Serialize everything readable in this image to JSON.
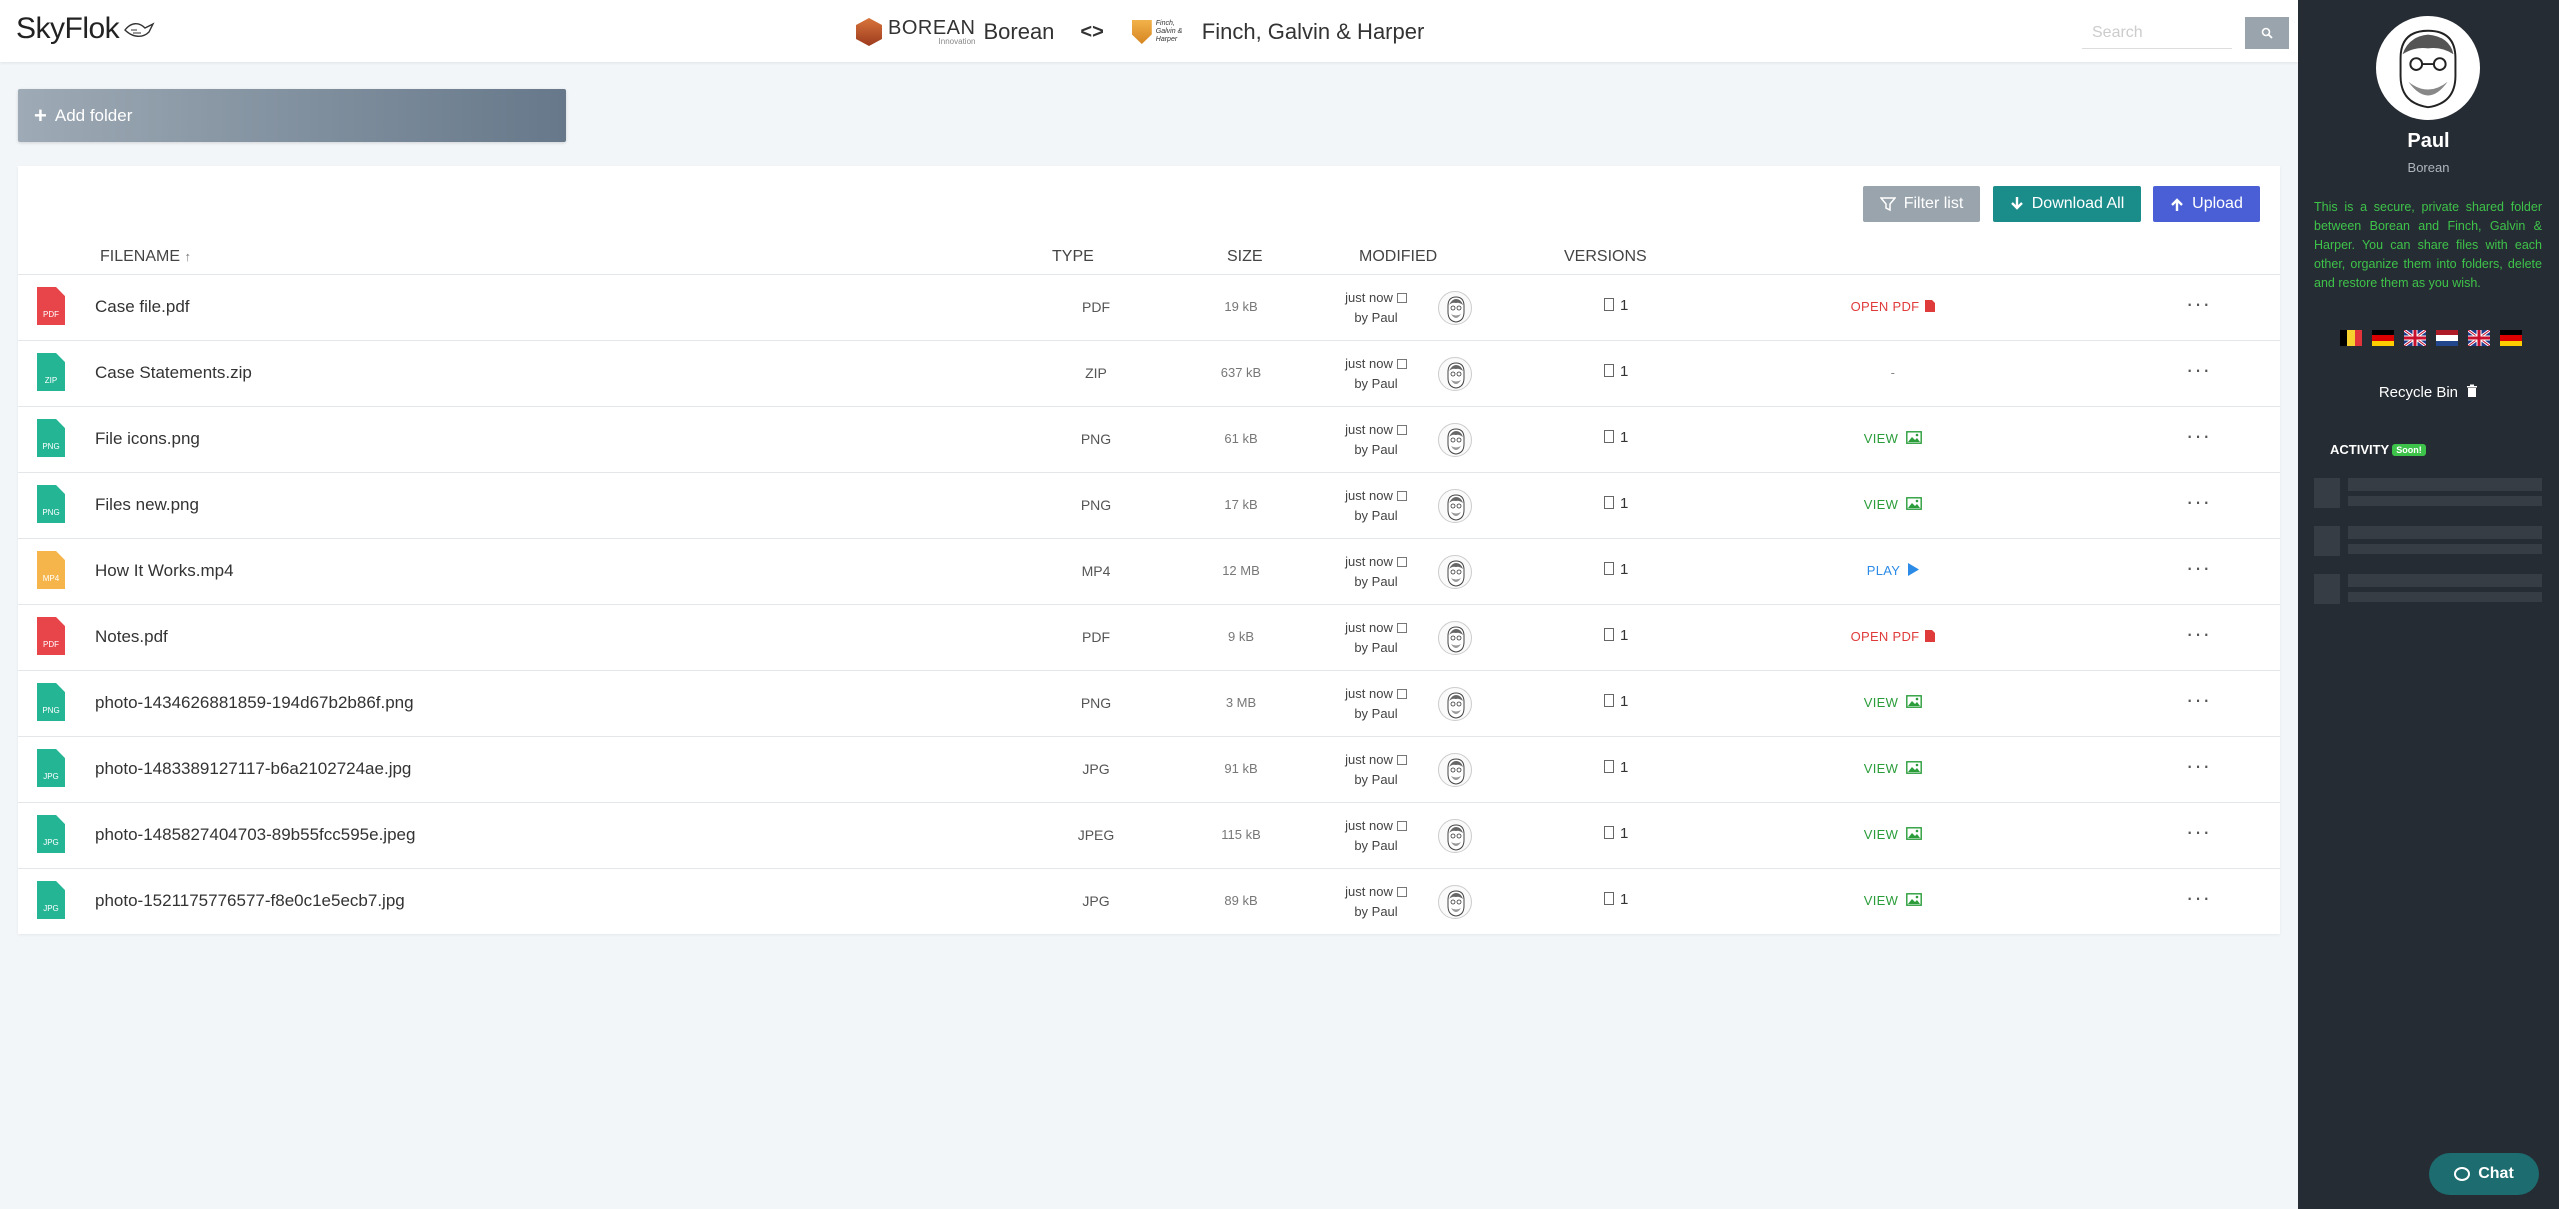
{
  "header": {
    "logo": "SkyFlok",
    "party1": {
      "brand": "BOREAN",
      "tagline": "Innovation",
      "name": "Borean"
    },
    "party2": {
      "mini": "Finch, Galvin & Harper",
      "name": "Finch, Galvin & Harper"
    },
    "swap_symbol": "<>",
    "search_placeholder": "Search"
  },
  "actions": {
    "add_folder": "Add folder",
    "filter": "Filter list",
    "download_all": "Download All",
    "upload": "Upload"
  },
  "columns": {
    "filename": "FILENAME",
    "sort_indicator": "↑",
    "type": "TYPE",
    "size": "SIZE",
    "modified": "MODIFIED",
    "versions": "VERSIONS"
  },
  "files": [
    {
      "icon_ext": "PDF",
      "icon_color": "#e8454a",
      "name": "Case file.pdf",
      "type": "PDF",
      "size": "19 kB",
      "modified": "just now",
      "by": "by Paul",
      "versions": "1",
      "action": "OPEN PDF",
      "action_kind": "pdf"
    },
    {
      "icon_ext": "ZIP",
      "icon_color": "#24b595",
      "name": "Case Statements.zip",
      "type": "ZIP",
      "size": "637 kB",
      "modified": "just now",
      "by": "by Paul",
      "versions": "1",
      "action": "-",
      "action_kind": "none"
    },
    {
      "icon_ext": "PNG",
      "icon_color": "#24b595",
      "name": "File icons.png",
      "type": "PNG",
      "size": "61 kB",
      "modified": "just now",
      "by": "by Paul",
      "versions": "1",
      "action": "VIEW",
      "action_kind": "view"
    },
    {
      "icon_ext": "PNG",
      "icon_color": "#24b595",
      "name": "Files new.png",
      "type": "PNG",
      "size": "17 kB",
      "modified": "just now",
      "by": "by Paul",
      "versions": "1",
      "action": "VIEW",
      "action_kind": "view"
    },
    {
      "icon_ext": "MP4",
      "icon_color": "#f5b54a",
      "name": "How It Works.mp4",
      "type": "MP4",
      "size": "12 MB",
      "modified": "just now",
      "by": "by Paul",
      "versions": "1",
      "action": "PLAY",
      "action_kind": "play"
    },
    {
      "icon_ext": "PDF",
      "icon_color": "#e8454a",
      "name": "Notes.pdf",
      "type": "PDF",
      "size": "9 kB",
      "modified": "just now",
      "by": "by Paul",
      "versions": "1",
      "action": "OPEN PDF",
      "action_kind": "pdf"
    },
    {
      "icon_ext": "PNG",
      "icon_color": "#24b595",
      "name": "photo-1434626881859-194d67b2b86f.png",
      "type": "PNG",
      "size": "3 MB",
      "modified": "just now",
      "by": "by Paul",
      "versions": "1",
      "action": "VIEW",
      "action_kind": "view"
    },
    {
      "icon_ext": "JPG",
      "icon_color": "#24b595",
      "name": "photo-1483389127117-b6a2102724ae.jpg",
      "type": "JPG",
      "size": "91 kB",
      "modified": "just now",
      "by": "by Paul",
      "versions": "1",
      "action": "VIEW",
      "action_kind": "view"
    },
    {
      "icon_ext": "JPG",
      "icon_color": "#24b595",
      "name": "photo-1485827404703-89b55fcc595e.jpeg",
      "type": "JPEG",
      "size": "115 kB",
      "modified": "just now",
      "by": "by Paul",
      "versions": "1",
      "action": "VIEW",
      "action_kind": "view"
    },
    {
      "icon_ext": "JPG",
      "icon_color": "#24b595",
      "name": "photo-1521175776577-f8e0c1e5ecb7.jpg",
      "type": "JPG",
      "size": "89 kB",
      "modified": "just now",
      "by": "by Paul",
      "versions": "1",
      "action": "VIEW",
      "action_kind": "view"
    }
  ],
  "sidebar": {
    "user_name": "Paul",
    "org": "Borean",
    "info": "This is a secure, private shared folder between Borean and Finch, Galvin & Harper. You can share files with each other, organize them into folders, delete and restore them as you wish.",
    "flags": [
      "be",
      "de",
      "gb",
      "nl",
      "gb",
      "de"
    ],
    "recycle_bin": "Recycle Bin",
    "activity": "ACTIVITY",
    "soon": "Soon!"
  },
  "chat": {
    "label": "Chat"
  },
  "colors": {
    "accent_teal": "#1a8c8a",
    "upload_blue": "#4a5fd6",
    "sidebar_bg": "#262c33",
    "info_green": "#3ec34a"
  }
}
